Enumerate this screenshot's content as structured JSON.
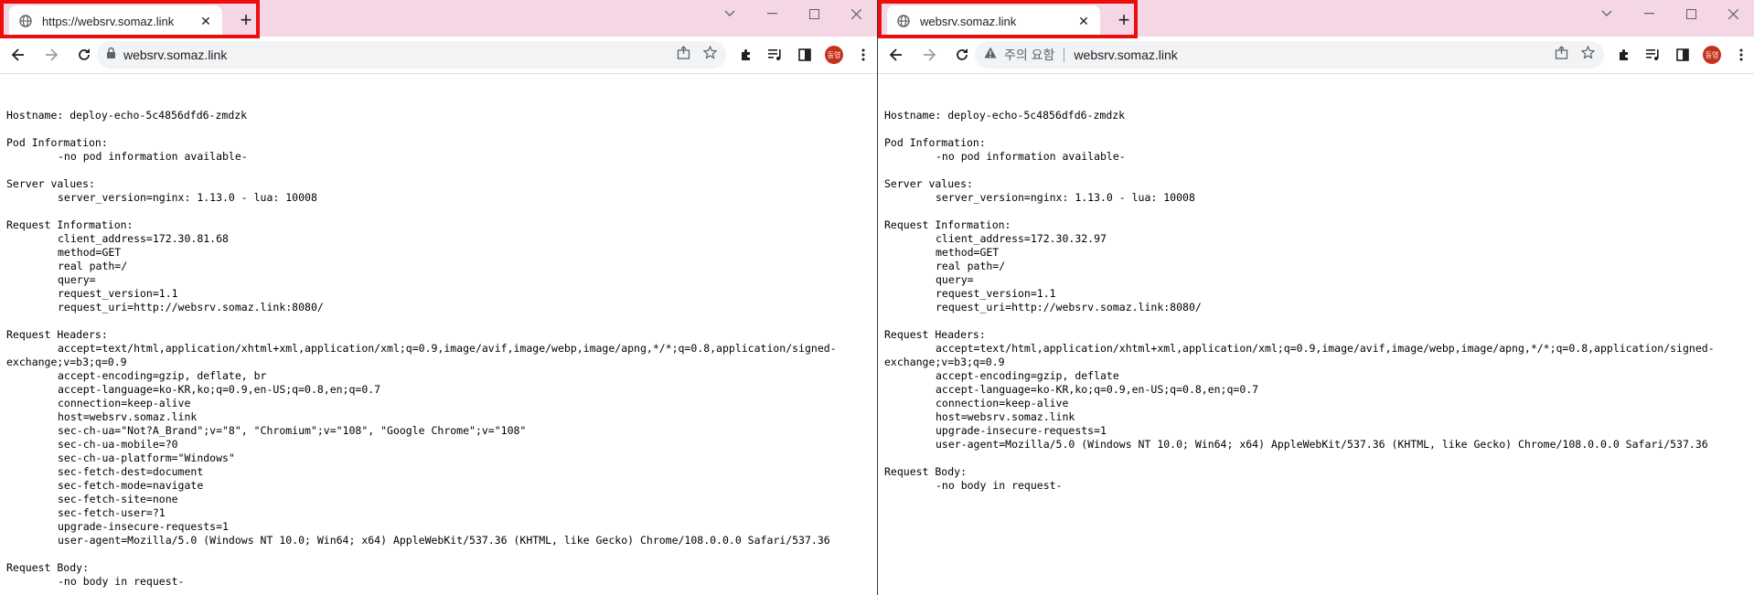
{
  "windows": [
    {
      "tab": {
        "title": "https://websrv.somaz.link"
      },
      "address": {
        "warning": "",
        "url": "websrv.somaz.link",
        "secure": true
      },
      "avatar": "동영",
      "page": {
        "hostname": "Hostname: deploy-echo-5c4856dfd6-zmdzk",
        "pod_header": "Pod Information:",
        "pod_lines": [
          "-no pod information available-"
        ],
        "server_header": "Server values:",
        "server_lines": [
          "server_version=nginx: 1.13.0 - lua: 10008"
        ],
        "request_header": "Request Information:",
        "request_lines": [
          "client_address=172.30.81.68",
          "method=GET",
          "real path=/",
          "query=",
          "request_version=1.1",
          "request_uri=http://websrv.somaz.link:8080/"
        ],
        "headers_header": "Request Headers:",
        "accept_line": "accept=text/html,application/xhtml+xml,application/xml;q=0.9,image/avif,image/webp,image/apng,*/*;q=0.8,application/signed-exchange;v=b3;q=0.9",
        "header_lines": [
          "accept-encoding=gzip, deflate, br",
          "accept-language=ko-KR,ko;q=0.9,en-US;q=0.8,en;q=0.7",
          "connection=keep-alive",
          "host=websrv.somaz.link",
          "sec-ch-ua=\"Not?A_Brand\";v=\"8\", \"Chromium\";v=\"108\", \"Google Chrome\";v=\"108\"",
          "sec-ch-ua-mobile=?0",
          "sec-ch-ua-platform=\"Windows\"",
          "sec-fetch-dest=document",
          "sec-fetch-mode=navigate",
          "sec-fetch-site=none",
          "sec-fetch-user=?1",
          "upgrade-insecure-requests=1",
          "user-agent=Mozilla/5.0 (Windows NT 10.0; Win64; x64) AppleWebKit/537.36 (KHTML, like Gecko) Chrome/108.0.0.0 Safari/537.36"
        ],
        "body_header": "Request Body:",
        "body_lines": [
          "-no body in request-"
        ]
      }
    },
    {
      "tab": {
        "title": "websrv.somaz.link"
      },
      "address": {
        "warning": "주의 요함",
        "url": "websrv.somaz.link",
        "secure": false
      },
      "avatar": "동영",
      "page": {
        "hostname": "Hostname: deploy-echo-5c4856dfd6-zmdzk",
        "pod_header": "Pod Information:",
        "pod_lines": [
          "-no pod information available-"
        ],
        "server_header": "Server values:",
        "server_lines": [
          "server_version=nginx: 1.13.0 - lua: 10008"
        ],
        "request_header": "Request Information:",
        "request_lines": [
          "client_address=172.30.32.97",
          "method=GET",
          "real path=/",
          "query=",
          "request_version=1.1",
          "request_uri=http://websrv.somaz.link:8080/"
        ],
        "headers_header": "Request Headers:",
        "accept_line": "accept=text/html,application/xhtml+xml,application/xml;q=0.9,image/avif,image/webp,image/apng,*/*;q=0.8,application/signed-exchange;v=b3;q=0.9",
        "header_lines": [
          "accept-encoding=gzip, deflate",
          "accept-language=ko-KR,ko;q=0.9,en-US;q=0.8,en;q=0.7",
          "connection=keep-alive",
          "host=websrv.somaz.link",
          "upgrade-insecure-requests=1",
          "user-agent=Mozilla/5.0 (Windows NT 10.0; Win64; x64) AppleWebKit/537.36 (KHTML, like Gecko) Chrome/108.0.0.0 Safari/537.36"
        ],
        "body_header": "Request Body:",
        "body_lines": [
          "-no body in request-"
        ]
      }
    }
  ],
  "colors": {
    "titlebar": "#f4d6e4",
    "highlight": "#ee0d0d",
    "avatar": "#c5311b"
  }
}
